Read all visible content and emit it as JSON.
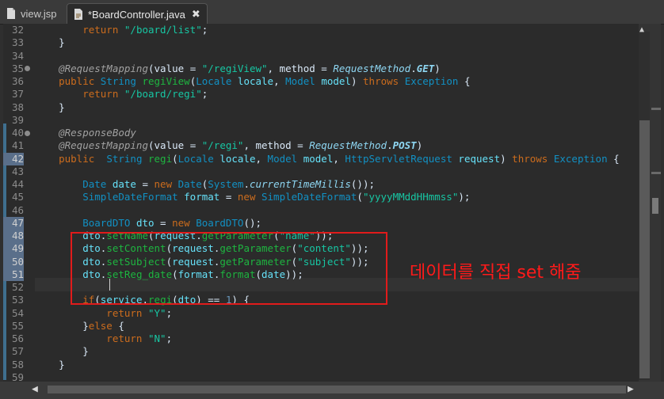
{
  "tabs": [
    {
      "label": "view.jsp",
      "active": false
    },
    {
      "label": "*BoardController.java",
      "active": true
    }
  ],
  "tab_close_glyph": "✖",
  "line_numbers": [
    "32",
    "33",
    "34",
    "35",
    "36",
    "37",
    "38",
    "39",
    "40",
    "41",
    "42",
    "43",
    "44",
    "45",
    "46",
    "47",
    "48",
    "49",
    "50",
    "51",
    "52",
    "53",
    "54",
    "55",
    "56",
    "57",
    "58",
    "59"
  ],
  "highlighted_line_numbers": [
    "42",
    "47",
    "48",
    "49",
    "50",
    "51"
  ],
  "fold_markers": [
    "35",
    "40"
  ],
  "annotation": {
    "text": "데이터를 직접 set 해줌",
    "color": "#e11b1b"
  },
  "code_lines": [
    [
      [
        "k",
        "        return "
      ],
      [
        "s",
        "\"/board/list\""
      ],
      [
        "p",
        ";"
      ]
    ],
    [
      [
        "p",
        "    }"
      ]
    ],
    [],
    [
      [
        "a",
        "    @RequestMapping"
      ],
      [
        "p",
        "("
      ],
      [
        "p",
        "value"
      ],
      [
        "p",
        " = "
      ],
      [
        "s",
        "\"/regiView\""
      ],
      [
        "p",
        ", "
      ],
      [
        "p",
        "method"
      ],
      [
        "p",
        " = "
      ],
      [
        "f",
        "RequestMethod"
      ],
      [
        "p",
        "."
      ],
      [
        "c",
        "GET"
      ],
      [
        "p",
        ")"
      ]
    ],
    [
      [
        "k",
        "    public "
      ],
      [
        "t",
        "String"
      ],
      [
        "p",
        " "
      ],
      [
        "m",
        "regiView"
      ],
      [
        "p",
        "("
      ],
      [
        "t",
        "Locale"
      ],
      [
        "p",
        " "
      ],
      [
        "v",
        "locale"
      ],
      [
        "p",
        ", "
      ],
      [
        "t",
        "Model"
      ],
      [
        "p",
        " "
      ],
      [
        "v",
        "model"
      ],
      [
        "p",
        ") "
      ],
      [
        "k",
        "throws "
      ],
      [
        "t",
        "Exception"
      ],
      [
        "p",
        " {"
      ]
    ],
    [
      [
        "k",
        "        return "
      ],
      [
        "s",
        "\"/board/regi\""
      ],
      [
        "p",
        ";"
      ]
    ],
    [
      [
        "p",
        "    }"
      ]
    ],
    [],
    [
      [
        "a",
        "    @ResponseBody"
      ]
    ],
    [
      [
        "a",
        "    @RequestMapping"
      ],
      [
        "p",
        "("
      ],
      [
        "p",
        "value"
      ],
      [
        "p",
        " = "
      ],
      [
        "s",
        "\"/regi\""
      ],
      [
        "p",
        ", "
      ],
      [
        "p",
        "method"
      ],
      [
        "p",
        " = "
      ],
      [
        "f",
        "RequestMethod"
      ],
      [
        "p",
        "."
      ],
      [
        "c",
        "POST"
      ],
      [
        "p",
        ")"
      ]
    ],
    [
      [
        "k",
        "    public  "
      ],
      [
        "t",
        "String"
      ],
      [
        "p",
        " "
      ],
      [
        "m",
        "regi"
      ],
      [
        "p",
        "("
      ],
      [
        "t",
        "Locale"
      ],
      [
        "p",
        " "
      ],
      [
        "v",
        "locale"
      ],
      [
        "p",
        ", "
      ],
      [
        "t",
        "Model"
      ],
      [
        "p",
        " "
      ],
      [
        "v",
        "model"
      ],
      [
        "p",
        ", "
      ],
      [
        "t",
        "HttpServletRequest"
      ],
      [
        "p",
        " "
      ],
      [
        "v",
        "request"
      ],
      [
        "p",
        ") "
      ],
      [
        "k",
        "throws "
      ],
      [
        "t",
        "Exception"
      ],
      [
        "p",
        " {"
      ]
    ],
    [],
    [
      [
        "t",
        "        Date"
      ],
      [
        "p",
        " "
      ],
      [
        "v",
        "date"
      ],
      [
        "p",
        " = "
      ],
      [
        "k",
        "new "
      ],
      [
        "t",
        "Date"
      ],
      [
        "p",
        "("
      ],
      [
        "t",
        "System"
      ],
      [
        "p",
        "."
      ],
      [
        "f",
        "currentTimeMillis"
      ],
      [
        "p",
        "());"
      ]
    ],
    [
      [
        "t",
        "        SimpleDateFormat"
      ],
      [
        "p",
        " "
      ],
      [
        "v",
        "format"
      ],
      [
        "p",
        " = "
      ],
      [
        "k",
        "new "
      ],
      [
        "t",
        "SimpleDateFormat"
      ],
      [
        "p",
        "("
      ],
      [
        "s",
        "\"yyyyMMddHHmmss\""
      ],
      [
        "p",
        ");"
      ]
    ],
    [],
    [
      [
        "t",
        "        BoardDTO"
      ],
      [
        "p",
        " "
      ],
      [
        "v",
        "dto"
      ],
      [
        "p",
        " = "
      ],
      [
        "k",
        "new "
      ],
      [
        "t",
        "BoardDTO"
      ],
      [
        "p",
        "();"
      ]
    ],
    [
      [
        "v",
        "        dto"
      ],
      [
        "p",
        "."
      ],
      [
        "m",
        "setName"
      ],
      [
        "p",
        "("
      ],
      [
        "v",
        "request"
      ],
      [
        "p",
        "."
      ],
      [
        "m",
        "getParameter"
      ],
      [
        "p",
        "("
      ],
      [
        "s",
        "\"name\""
      ],
      [
        "p",
        "));"
      ]
    ],
    [
      [
        "v",
        "        dto"
      ],
      [
        "p",
        "."
      ],
      [
        "m",
        "setContent"
      ],
      [
        "p",
        "("
      ],
      [
        "v",
        "request"
      ],
      [
        "p",
        "."
      ],
      [
        "m",
        "getParameter"
      ],
      [
        "p",
        "("
      ],
      [
        "s",
        "\"content\""
      ],
      [
        "p",
        "));"
      ]
    ],
    [
      [
        "v",
        "        dto"
      ],
      [
        "p",
        "."
      ],
      [
        "m",
        "setSubject"
      ],
      [
        "p",
        "("
      ],
      [
        "v",
        "request"
      ],
      [
        "p",
        "."
      ],
      [
        "m",
        "getParameter"
      ],
      [
        "p",
        "("
      ],
      [
        "s",
        "\"subject\""
      ],
      [
        "p",
        "));"
      ]
    ],
    [
      [
        "v",
        "        dto"
      ],
      [
        "p",
        "."
      ],
      [
        "m",
        "setReg_date"
      ],
      [
        "p",
        "("
      ],
      [
        "v",
        "format"
      ],
      [
        "p",
        "."
      ],
      [
        "m",
        "format"
      ],
      [
        "p",
        "("
      ],
      [
        "v",
        "date"
      ],
      [
        "p",
        "));"
      ]
    ],
    [],
    [
      [
        "k",
        "        if"
      ],
      [
        "p",
        "("
      ],
      [
        "v",
        "service"
      ],
      [
        "p",
        "."
      ],
      [
        "m",
        "regi"
      ],
      [
        "p",
        "("
      ],
      [
        "v",
        "dto"
      ],
      [
        "p",
        ") == "
      ],
      [
        "n",
        "1"
      ],
      [
        "p",
        ") {"
      ]
    ],
    [
      [
        "k",
        "            return "
      ],
      [
        "s",
        "\"Y\""
      ],
      [
        "p",
        ";"
      ]
    ],
    [
      [
        "p",
        "        }"
      ],
      [
        "k",
        "else"
      ],
      [
        "p",
        " {"
      ]
    ],
    [
      [
        "k",
        "            return "
      ],
      [
        "s",
        "\"N\""
      ],
      [
        "p",
        ";"
      ]
    ],
    [
      [
        "p",
        "        }"
      ]
    ],
    [
      [
        "p",
        "    }"
      ]
    ],
    []
  ]
}
